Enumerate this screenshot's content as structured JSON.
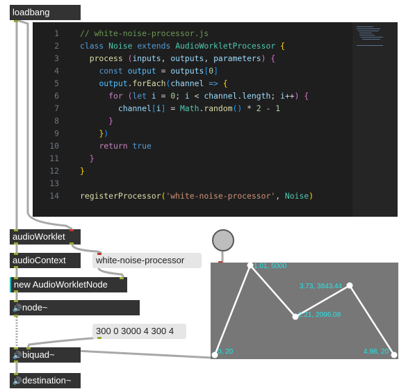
{
  "objects": {
    "loadbang": "loadbang",
    "audio_worklet": "audioWorklet",
    "audio_context": "audioContext",
    "new_node": "new AudioWorkletNode",
    "node": "node~",
    "biquad": "biquad~",
    "destination": "destination~"
  },
  "messages": {
    "processor_name": "white-noise-processor",
    "envelope_list": "300 0 3000 4 300 4"
  },
  "editor": {
    "line_numbers": [
      "1",
      "2",
      "3",
      "4",
      "5",
      "6",
      "7",
      "8",
      "9",
      "10",
      "11",
      "12",
      "13",
      "14"
    ]
  },
  "envelope": {
    "labels": [
      "0, 20",
      "1.01, 5000",
      "2.21, 2096.08",
      "3.73, 3843.44",
      "4.98, 20"
    ]
  },
  "colors": {
    "object_bg": "#333333",
    "editor_bg": "#1e1e1e",
    "envelope_bg": "#777777",
    "envelope_label": "#22e6e6",
    "inlet": "#99aa33",
    "outlet_active": "#c0392b"
  },
  "icons": [
    "speaker-icon"
  ]
}
